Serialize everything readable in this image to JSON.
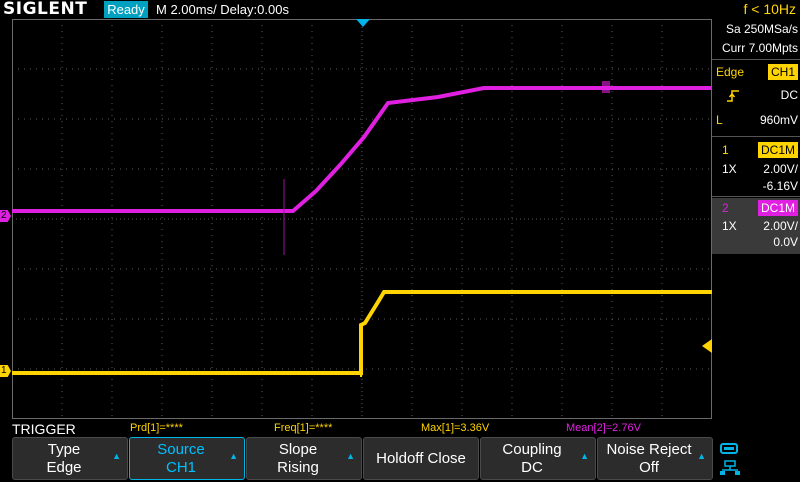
{
  "header": {
    "brand": "SIGLENT",
    "run_status": "Ready",
    "timebase": "M 2.00ms/ Delay:0.00s",
    "trigger_frequency": "f < 10Hz"
  },
  "acquisition": {
    "sample_rate": "Sa 250MSa/s",
    "memory_depth": "Curr 7.00Mpts"
  },
  "trigger_info": {
    "type": "Edge",
    "source": "CH1",
    "coupling": "DC",
    "level_label": "L",
    "level": "960mV"
  },
  "channels": [
    {
      "number": "1",
      "coupling": "DC1M",
      "probe": "1X",
      "scale": "2.00V/",
      "offset": "-6.16V",
      "color": "#ffd400"
    },
    {
      "number": "2",
      "coupling": "DC1M",
      "probe": "1X",
      "scale": "2.00V/",
      "offset": "0.0V",
      "color": "#e020e0"
    }
  ],
  "measurements": {
    "menu_title": "TRIGGER",
    "prd": "Prd[1]=****",
    "freq": "Freq[1]=****",
    "max": "Max[1]=3.36V",
    "mean": "Mean[2]=2.76V"
  },
  "softkeys": [
    {
      "line1": "Type",
      "line2": "Edge",
      "arrow": true,
      "selected": false
    },
    {
      "line1": "Source",
      "line2": "CH1",
      "arrow": true,
      "selected": true
    },
    {
      "line1": "Slope",
      "line2": "Rising",
      "arrow": true,
      "selected": false
    },
    {
      "line1": "Holdoff Close",
      "line2": "",
      "arrow": false,
      "selected": false
    },
    {
      "line1": "Coupling",
      "line2": "DC",
      "arrow": true,
      "selected": false
    },
    {
      "line1": "Noise Reject",
      "line2": "Off",
      "arrow": true,
      "selected": false
    }
  ],
  "markers": {
    "ch1": "1",
    "ch2": "2"
  },
  "colors": {
    "ch1": "#ffd400",
    "ch2": "#e020e0",
    "accent": "#00b4e6",
    "grid": "#5a5a5a"
  }
}
